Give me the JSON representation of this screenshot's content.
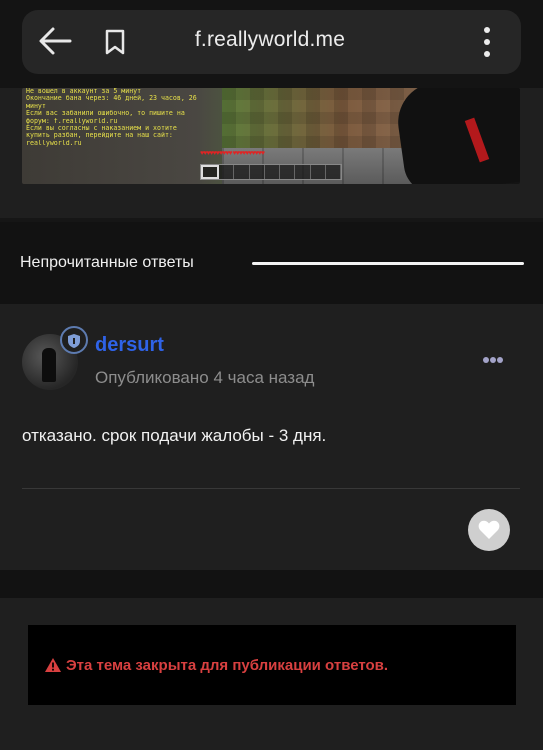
{
  "browser": {
    "url": "f.reallyworld.me",
    "icons": {
      "back": "back-arrow-icon",
      "bookmark": "bookmark-icon",
      "menu": "kebab-menu-icon"
    }
  },
  "preview": {
    "chat_lines": [
      {
        "text": "Не вошел в аккаунт за 5 минут",
        "color": "#e7e04a"
      },
      {
        "text": "Окончание бана через: 46 дней, 23 часов, 26",
        "color": "#e7e04a"
      },
      {
        "text": "минут",
        "color": "#e7e04a"
      },
      {
        "text": "Если вас забанили ошибочно, то пишите на",
        "color": "#e7e04a"
      },
      {
        "text": "форум: f.reallyworld.ru",
        "color": "#e7e04a"
      },
      {
        "text": "Если вы согласны с наказанием и хотите",
        "color": "#e7e04a"
      },
      {
        "text": "купить разбан, перейдите на наш сайт:",
        "color": "#e7e04a"
      },
      {
        "text": "reallyworld.ru",
        "color": "#e7e04a"
      }
    ],
    "hearts": "♥♥♥♥♥♥♥♥♥♥   ♥♥♥♥♥♥♥♥♥♥"
  },
  "unread": {
    "label": "Непрочитанные ответы"
  },
  "comment": {
    "author": "dersurt",
    "published": "Опубликовано 4 часа назад",
    "text": "отказано. срок подачи жалобы - 3 дня.",
    "icons": {
      "badge": "shield-badge-icon",
      "more": "more-dots-icon",
      "like": "heart-icon"
    }
  },
  "locked_notice": {
    "text": "Эта тема закрыта для публикации ответов.",
    "icon": "warning-icon"
  },
  "colors": {
    "accent_author": "#2f63e8",
    "warning": "#d84040"
  }
}
